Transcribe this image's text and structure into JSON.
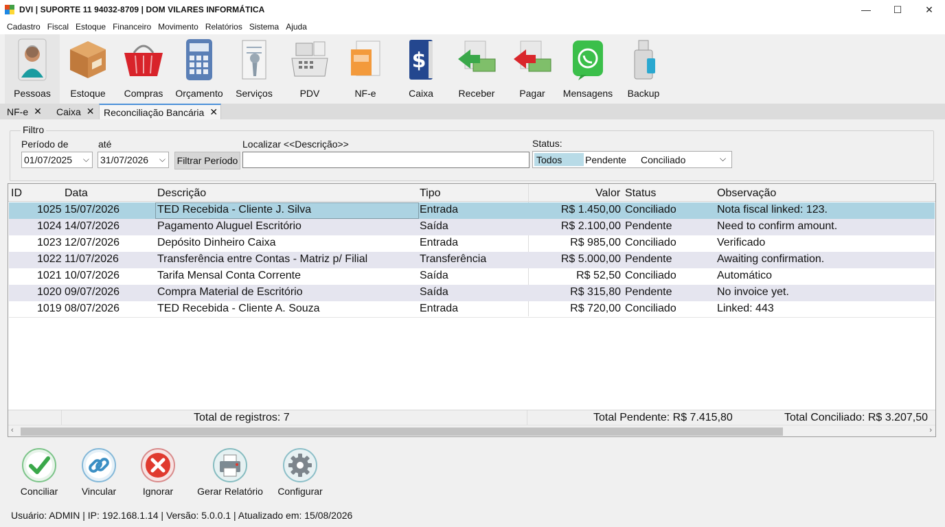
{
  "window": {
    "title": "DVI | SUPORTE 11 94032-8709 | DOM VILARES INFORMÁTICA",
    "minimize": "—",
    "maximize": "☐",
    "close": "✕"
  },
  "menu": [
    "Cadastro",
    "Fiscal",
    "Estoque",
    "Financeiro",
    "Movimento",
    "Relatórios",
    "Sistema",
    "Ajuda"
  ],
  "toolbar": [
    {
      "label": "Pessoas",
      "icon": "person-icon"
    },
    {
      "label": "Estoque",
      "icon": "box-icon"
    },
    {
      "label": "Compras",
      "icon": "basket-icon"
    },
    {
      "label": "Orçamento",
      "icon": "calculator-icon"
    },
    {
      "label": "Serviços",
      "icon": "wrench-document-icon"
    },
    {
      "label": "PDV",
      "icon": "cash-register-icon"
    },
    {
      "label": "NF-e",
      "icon": "invoice-icon"
    },
    {
      "label": "Caixa",
      "icon": "money-book-icon"
    },
    {
      "label": "Receber",
      "icon": "receive-money-icon"
    },
    {
      "label": "Pagar",
      "icon": "pay-money-icon"
    },
    {
      "label": "Mensagens",
      "icon": "whatsapp-icon"
    },
    {
      "label": "Backup",
      "icon": "usb-drive-icon"
    }
  ],
  "tabs": [
    {
      "label": "NF-e"
    },
    {
      "label": "Caixa"
    },
    {
      "label": "Reconciliação Bancária"
    }
  ],
  "filter": {
    "legend": "Filtro",
    "period_from_label": "Período de",
    "period_from_value": "01/07/2025",
    "period_to_label": "até",
    "period_to_value": "31/07/2026",
    "filter_button": "Filtrar Período",
    "search_label": "Localizar <<Descrição>>",
    "search_value": "",
    "status_label": "Status:",
    "status_options": [
      "Todos",
      "Pendente",
      "Conciliado"
    ],
    "status_selected": "Todos"
  },
  "grid": {
    "columns": [
      "ID",
      "Data",
      "Descrição",
      "Tipo",
      "Valor",
      "Status",
      "Observação"
    ],
    "rows": [
      {
        "id": "1025",
        "data": "15/07/2026",
        "descricao": "TED Recebida - Cliente J. Silva",
        "tipo": "Entrada",
        "valor": "R$ 1.450,00",
        "status": "Conciliado",
        "obs": "Nota fiscal linked: 123."
      },
      {
        "id": "1024",
        "data": "14/07/2026",
        "descricao": "Pagamento Aluguel Escritório",
        "tipo": "Saída",
        "valor": "R$ 2.100,00",
        "status": "Pendente",
        "obs": "Need to confirm amount."
      },
      {
        "id": "1023",
        "data": "12/07/2026",
        "descricao": "Depósito Dinheiro Caixa",
        "tipo": "Entrada",
        "valor": "R$ 985,00",
        "status": "Conciliado",
        "obs": "Verificado"
      },
      {
        "id": "1022",
        "data": "11/07/2026",
        "descricao": "Transferência entre Contas - Matriz p/ Filial",
        "tipo": "Transferência",
        "valor": "R$ 5.000,00",
        "status": "Pendente",
        "obs": "Awaiting confirmation."
      },
      {
        "id": "1021",
        "data": "10/07/2026",
        "descricao": "Tarifa Mensal Conta Corrente",
        "tipo": "Saída",
        "valor": "R$ 52,50",
        "status": "Conciliado",
        "obs": "Automático"
      },
      {
        "id": "1020",
        "data": "09/07/2026",
        "descricao": "Compra Material de Escritório",
        "tipo": "Saída",
        "valor": "R$ 315,80",
        "status": "Pendente",
        "obs": "No invoice yet."
      },
      {
        "id": "1019",
        "data": "08/07/2026",
        "descricao": "TED Recebida - Cliente A. Souza",
        "tipo": "Entrada",
        "valor": "R$ 720,00",
        "status": "Conciliado",
        "obs": "Linked: 443"
      }
    ],
    "footer": {
      "total_records": "Total de registros: 7",
      "total_pending": "Total Pendente: R$ 7.415,80",
      "total_reconciled": "Total Conciliado: R$ 3.207,50"
    }
  },
  "actions": [
    {
      "label": "Conciliar",
      "icon": "check-icon"
    },
    {
      "label": "Vincular",
      "icon": "link-icon"
    },
    {
      "label": "Ignorar",
      "icon": "cancel-icon"
    },
    {
      "label": "Gerar Relatório",
      "icon": "printer-icon"
    },
    {
      "label": "Configurar",
      "icon": "gear-icon"
    }
  ],
  "statusbar": "Usuário: ADMIN | IP: 192.168.1.14 | Versão: 5.0.0.1 | Atualizado em: 15/08/2026",
  "colors": {
    "selected_row": "#acd3e2",
    "alt_row": "#e5e5ef",
    "status_todos_highlight": "#b8dbe7"
  }
}
